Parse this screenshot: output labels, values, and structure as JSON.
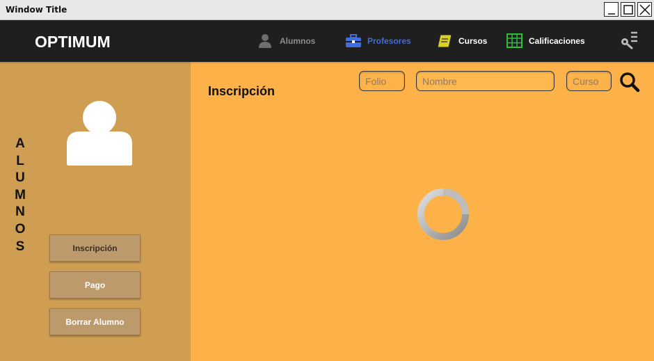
{
  "window": {
    "title": "Window Title"
  },
  "navbar": {
    "brand": "OPTIMUM",
    "items": [
      {
        "label": "Alumnos",
        "icon": "user-icon",
        "color": "#8c8c8c"
      },
      {
        "label": "Profesores",
        "icon": "briefcase-icon",
        "color": "#3f6ee0"
      },
      {
        "label": "Cursos",
        "icon": "book-icon",
        "color": "#ffffff"
      },
      {
        "label": "Calificaciones",
        "icon": "grid-icon",
        "color": "#ffffff"
      }
    ],
    "settings_icon": "key-settings-icon"
  },
  "sidebar": {
    "vertical_label": [
      "A",
      "L",
      "U",
      "M",
      "N",
      "O",
      "S"
    ],
    "buttons": [
      "Inscripción",
      "Pago",
      "Borrar Alumno"
    ],
    "active_button": "Inscripción"
  },
  "main": {
    "title": "Inscripción",
    "search": {
      "folio_placeholder": "Folio",
      "nombre_placeholder": "Nombre",
      "curso_placeholder": "Curso"
    },
    "loading": true
  },
  "colors": {
    "navbar_bg": "#1f1f1f",
    "sidebar_bg": "#cf9e52",
    "main_bg": "#fcb248",
    "button_bg": "#bd9a6b",
    "active_nav": "#3f6ee0"
  }
}
